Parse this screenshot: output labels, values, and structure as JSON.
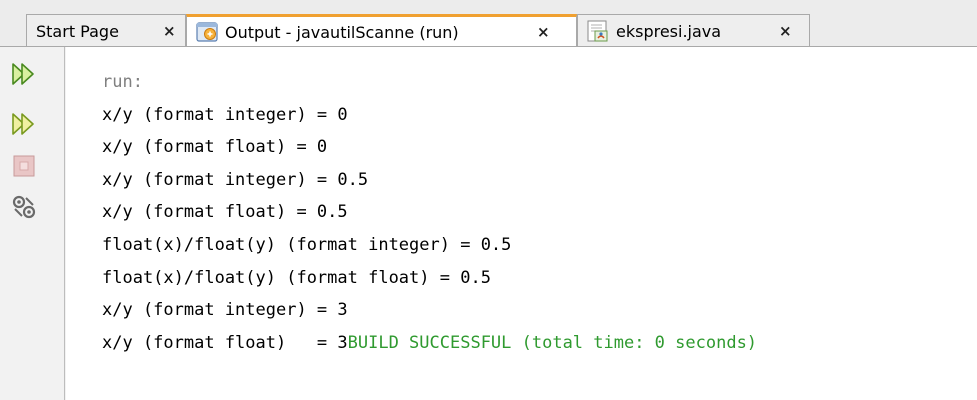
{
  "tabs": [
    {
      "label": "Start Page",
      "close": "×"
    },
    {
      "label": "Output - javautilScanne (run)",
      "close": "×"
    },
    {
      "label": "ekspresi.java",
      "close": "×"
    }
  ],
  "toolbar": {
    "rerun_icon": "double-play-icon",
    "rerun2_icon": "double-play-icon",
    "stop_icon": "stop-icon",
    "settings_icon": "settings-icon"
  },
  "output": {
    "run_line": "run:",
    "lines": [
      "x/y (format integer) = 0",
      "x/y (format float) = 0",
      "x/y (format integer) = 0.5",
      "x/y (format float) = 0.5",
      "float(x)/float(y) (format integer) = 0.5",
      "float(x)/float(y) (format float) = 0.5",
      "x/y (format integer) = 3"
    ],
    "last_line_prefix": "x/y (format float)   = 3",
    "build_status": "BUILD SUCCESSFUL (total time: 0 seconds)"
  },
  "colors": {
    "active_tab_accent": "#f0a030",
    "success_text": "#2f9a2f",
    "run_text": "#808080"
  }
}
